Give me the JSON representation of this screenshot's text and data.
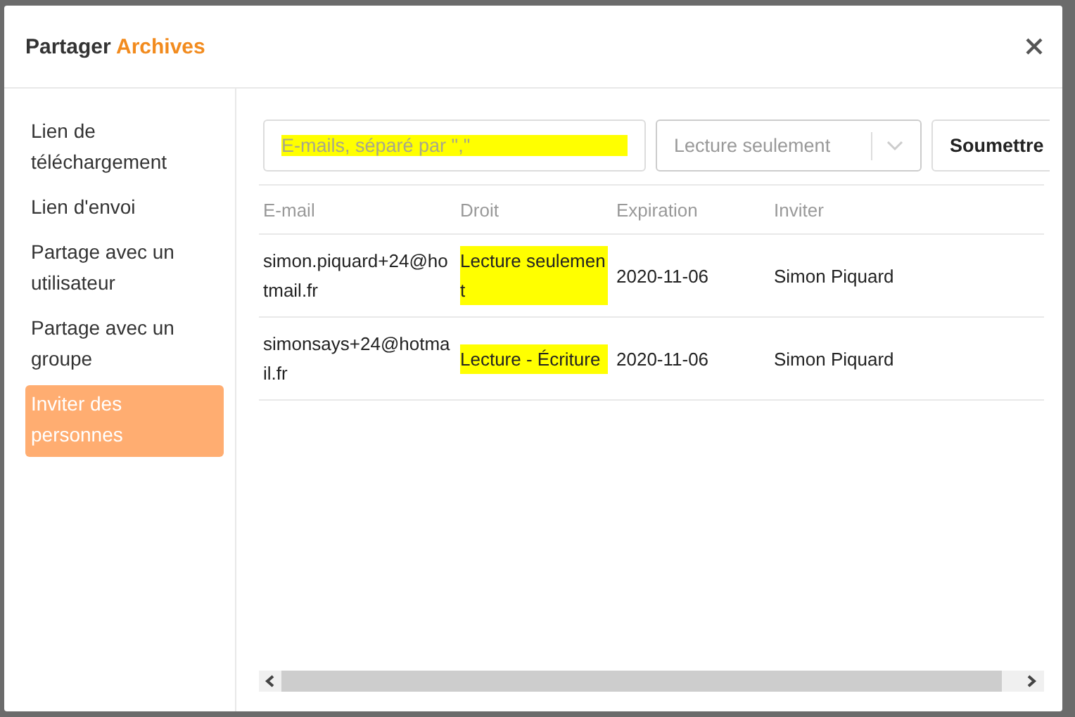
{
  "dialog": {
    "title": "Partager",
    "title_highlight": "Archives"
  },
  "sidebar": {
    "items": [
      {
        "label": "Lien de téléchargement",
        "selected": false
      },
      {
        "label": "Lien d'envoi",
        "selected": false
      },
      {
        "label": "Partage avec un utilisateur",
        "selected": false
      },
      {
        "label": "Partage avec un groupe",
        "selected": false
      },
      {
        "label": "Inviter des personnes",
        "selected": true
      }
    ]
  },
  "invite_form": {
    "email_field": {
      "placeholder": "E-mails, séparé par \",\"",
      "highlighted": true
    },
    "rights_select": {
      "placeholder": "Lecture seulement"
    },
    "submit_button": "Soumettre"
  },
  "table": {
    "columns": [
      "E-mail",
      "Droit",
      "Expiration",
      "Inviter"
    ],
    "rows": [
      {
        "email": "simon.piquard+24@hotmail.fr",
        "right": "Lecture seulement",
        "right_highlighted": true,
        "expiration": "2020-11-06",
        "inviter": "Simon Piquard"
      },
      {
        "email": "simonsays+24@hotmail.fr",
        "right": "Lecture - Écriture",
        "right_highlighted": true,
        "expiration": "2020-11-06",
        "inviter": "Simon Piquard"
      }
    ]
  }
}
